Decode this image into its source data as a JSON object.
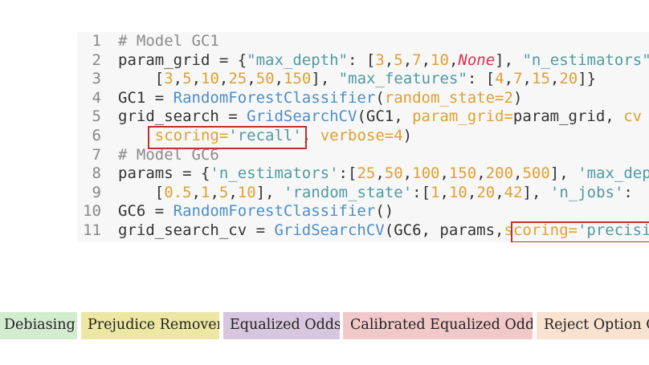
{
  "code": {
    "lines": [
      {
        "n": "1",
        "segments": [
          {
            "t": "# Model GC1",
            "c": "cmt"
          }
        ]
      },
      {
        "n": "2",
        "segments": [
          {
            "t": "param_grid = {",
            "c": ""
          },
          {
            "t": "\"max_depth\"",
            "c": "str"
          },
          {
            "t": ": [",
            "c": ""
          },
          {
            "t": "3",
            "c": "num"
          },
          {
            "t": ",",
            "c": ""
          },
          {
            "t": "5",
            "c": "num"
          },
          {
            "t": ",",
            "c": ""
          },
          {
            "t": "7",
            "c": "num"
          },
          {
            "t": ",",
            "c": ""
          },
          {
            "t": "10",
            "c": "num"
          },
          {
            "t": ",",
            "c": ""
          },
          {
            "t": "None",
            "c": "none"
          },
          {
            "t": "], ",
            "c": ""
          },
          {
            "t": "\"n_estimators\"",
            "c": "str"
          },
          {
            "t": ":",
            "c": ""
          }
        ]
      },
      {
        "n": "3",
        "segments": [
          {
            "t": "    [",
            "c": ""
          },
          {
            "t": "3",
            "c": "num"
          },
          {
            "t": ",",
            "c": ""
          },
          {
            "t": "5",
            "c": "num"
          },
          {
            "t": ",",
            "c": ""
          },
          {
            "t": "10",
            "c": "num"
          },
          {
            "t": ",",
            "c": ""
          },
          {
            "t": "25",
            "c": "num"
          },
          {
            "t": ",",
            "c": ""
          },
          {
            "t": "50",
            "c": "num"
          },
          {
            "t": ",",
            "c": ""
          },
          {
            "t": "150",
            "c": "num"
          },
          {
            "t": "], ",
            "c": ""
          },
          {
            "t": "\"max_features\"",
            "c": "str"
          },
          {
            "t": ": [",
            "c": ""
          },
          {
            "t": "4",
            "c": "num"
          },
          {
            "t": ",",
            "c": ""
          },
          {
            "t": "7",
            "c": "num"
          },
          {
            "t": ",",
            "c": ""
          },
          {
            "t": "15",
            "c": "num"
          },
          {
            "t": ",",
            "c": ""
          },
          {
            "t": "20",
            "c": "num"
          },
          {
            "t": "]}",
            "c": ""
          }
        ]
      },
      {
        "n": "4",
        "segments": [
          {
            "t": "GC1 = ",
            "c": ""
          },
          {
            "t": "RandomForestClassifier",
            "c": "kw-cls"
          },
          {
            "t": "(",
            "c": ""
          },
          {
            "t": "random_state=",
            "c": "kwarg"
          },
          {
            "t": "2",
            "c": "num"
          },
          {
            "t": ")",
            "c": ""
          }
        ]
      },
      {
        "n": "5",
        "segments": [
          {
            "t": "grid_search = ",
            "c": ""
          },
          {
            "t": "GridSearchCV",
            "c": "kw-cls"
          },
          {
            "t": "(GC1, ",
            "c": ""
          },
          {
            "t": "param_grid=",
            "c": "kwarg"
          },
          {
            "t": "param_grid, ",
            "c": ""
          },
          {
            "t": "cv",
            "c": "kwarg"
          }
        ]
      },
      {
        "n": "6",
        "segments": [
          {
            "t": "    ",
            "c": ""
          },
          {
            "t": "scoring=",
            "c": "kwarg"
          },
          {
            "t": "'recall'",
            "c": "str"
          },
          {
            "t": ", ",
            "c": ""
          },
          {
            "t": "verbose=",
            "c": "kwarg"
          },
          {
            "t": "4",
            "c": "num"
          },
          {
            "t": ")",
            "c": ""
          }
        ]
      },
      {
        "n": "7",
        "segments": [
          {
            "t": "# Model GC6",
            "c": "cmt"
          }
        ]
      },
      {
        "n": "8",
        "segments": [
          {
            "t": "params = {",
            "c": ""
          },
          {
            "t": "'n_estimators'",
            "c": "str"
          },
          {
            "t": ":[",
            "c": ""
          },
          {
            "t": "25",
            "c": "num"
          },
          {
            "t": ",",
            "c": ""
          },
          {
            "t": "50",
            "c": "num"
          },
          {
            "t": ",",
            "c": ""
          },
          {
            "t": "100",
            "c": "num"
          },
          {
            "t": ",",
            "c": ""
          },
          {
            "t": "150",
            "c": "num"
          },
          {
            "t": ",",
            "c": ""
          },
          {
            "t": "200",
            "c": "num"
          },
          {
            "t": ",",
            "c": ""
          },
          {
            "t": "500",
            "c": "num"
          },
          {
            "t": "], ",
            "c": ""
          },
          {
            "t": "'max_depth'",
            "c": "str"
          }
        ]
      },
      {
        "n": "9",
        "segments": [
          {
            "t": "    [",
            "c": ""
          },
          {
            "t": "0.5",
            "c": "num"
          },
          {
            "t": ",",
            "c": ""
          },
          {
            "t": "1",
            "c": "num"
          },
          {
            "t": ",",
            "c": ""
          },
          {
            "t": "5",
            "c": "num"
          },
          {
            "t": ",",
            "c": ""
          },
          {
            "t": "10",
            "c": "num"
          },
          {
            "t": "], ",
            "c": ""
          },
          {
            "t": "'random_state'",
            "c": "str"
          },
          {
            "t": ":[",
            "c": ""
          },
          {
            "t": "1",
            "c": "num"
          },
          {
            "t": ",",
            "c": ""
          },
          {
            "t": "10",
            "c": "num"
          },
          {
            "t": ",",
            "c": ""
          },
          {
            "t": "20",
            "c": "num"
          },
          {
            "t": ",",
            "c": ""
          },
          {
            "t": "42",
            "c": "num"
          },
          {
            "t": "], ",
            "c": ""
          },
          {
            "t": "'n_jobs'",
            "c": "str"
          },
          {
            "t": ":",
            "c": ""
          }
        ]
      },
      {
        "n": "10",
        "segments": [
          {
            "t": "GC6 = ",
            "c": ""
          },
          {
            "t": "RandomForestClassifier",
            "c": "kw-cls"
          },
          {
            "t": "()",
            "c": ""
          }
        ]
      },
      {
        "n": "11",
        "segments": [
          {
            "t": "grid_search_cv = ",
            "c": ""
          },
          {
            "t": "GridSearchCV",
            "c": "kw-cls"
          },
          {
            "t": "(GC6, params,",
            "c": ""
          },
          {
            "t": "scoring=",
            "c": "kwarg"
          },
          {
            "t": "'precision'",
            "c": "str"
          }
        ]
      }
    ]
  },
  "tags": [
    {
      "label": "Debiasing",
      "color": "#d3ecd0"
    },
    {
      "label": "Prejudice Remover",
      "color": "#ece7a2"
    },
    {
      "label": "Equalized Odds",
      "color": "#d8c6de"
    },
    {
      "label": "Calibrated Equalized Odds",
      "color": "#f2c9c9"
    },
    {
      "label": "Reject Option Classification",
      "color": "#f9e2cf"
    }
  ],
  "colors": {
    "highlight_border": "#c0302c",
    "code_background": "#f7f7f7"
  }
}
